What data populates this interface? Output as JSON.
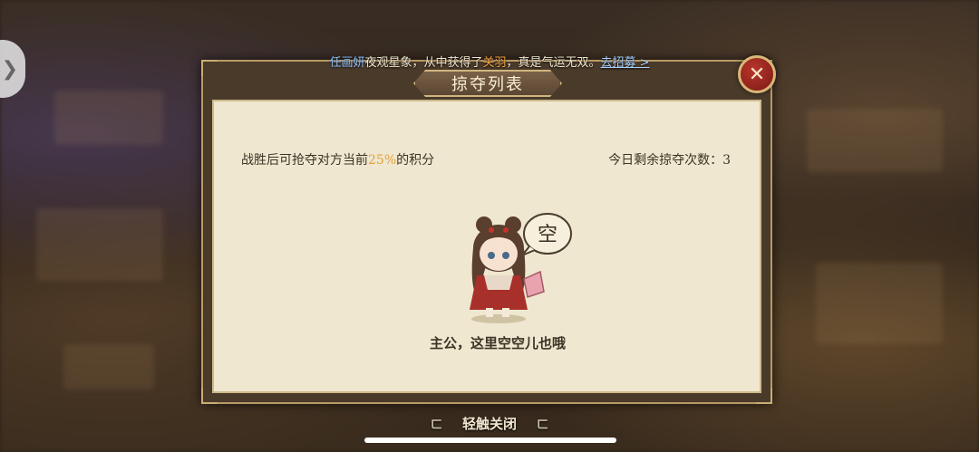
{
  "ticker": {
    "player_name": "任画妍",
    "text_1": "夜观星象，从中获得了",
    "hero_name": "关羽",
    "text_2": "，真是气运无双。",
    "link_label": "去招募 >"
  },
  "panel": {
    "title": "掠夺列表",
    "hint_prefix": "战胜后可抢夺对方当前",
    "hint_percent": "25%",
    "hint_suffix": "的积分",
    "remaining_label": "今日剩余掠夺次数：",
    "remaining_count": "3",
    "speech_bubble": "空",
    "empty_message": "主公，这里空空儿也哦"
  },
  "footer": {
    "tap_close_label": "轻触关闭",
    "left_ornament": "ㄈ",
    "right_ornament": "ㄈ"
  },
  "icons": {
    "close": "close-icon",
    "side_arrow": "chevron-right-icon"
  },
  "colors": {
    "highlight": "#e0a23a",
    "hero_name": "#f0a040",
    "player_name": "#8fc2ff",
    "close_button": "#b8352c"
  }
}
